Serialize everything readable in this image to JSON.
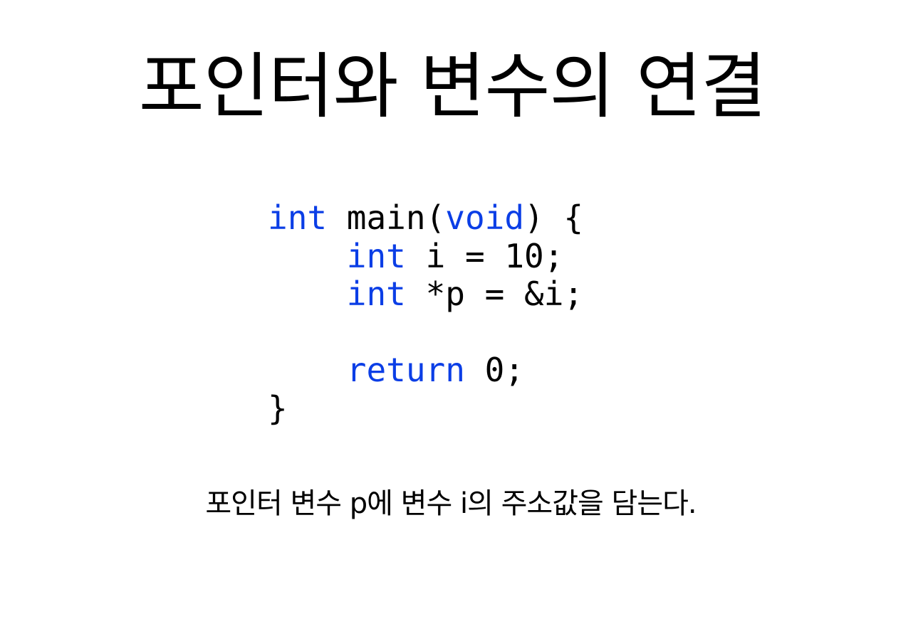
{
  "slide": {
    "title": "포인터와 변수의 연결",
    "caption": "포인터 변수 p에 변수 i의 주소값을 담는다."
  },
  "code": {
    "language": "c",
    "keyword_color": "#0b3ee6",
    "text_color": "#000000",
    "lines": [
      [
        {
          "text": "int",
          "kind": "keyword"
        },
        {
          "text": " main(",
          "kind": "plain"
        },
        {
          "text": "void",
          "kind": "keyword"
        },
        {
          "text": ") {",
          "kind": "plain"
        }
      ],
      [
        {
          "text": "    ",
          "kind": "plain"
        },
        {
          "text": "int",
          "kind": "keyword"
        },
        {
          "text": " i = 10;",
          "kind": "plain"
        }
      ],
      [
        {
          "text": "    ",
          "kind": "plain"
        },
        {
          "text": "int",
          "kind": "keyword"
        },
        {
          "text": " *p = &i;",
          "kind": "plain"
        }
      ],
      [],
      [
        {
          "text": "    ",
          "kind": "plain"
        },
        {
          "text": "return",
          "kind": "keyword"
        },
        {
          "text": " 0;",
          "kind": "plain"
        }
      ],
      [
        {
          "text": "}",
          "kind": "plain"
        }
      ]
    ]
  }
}
